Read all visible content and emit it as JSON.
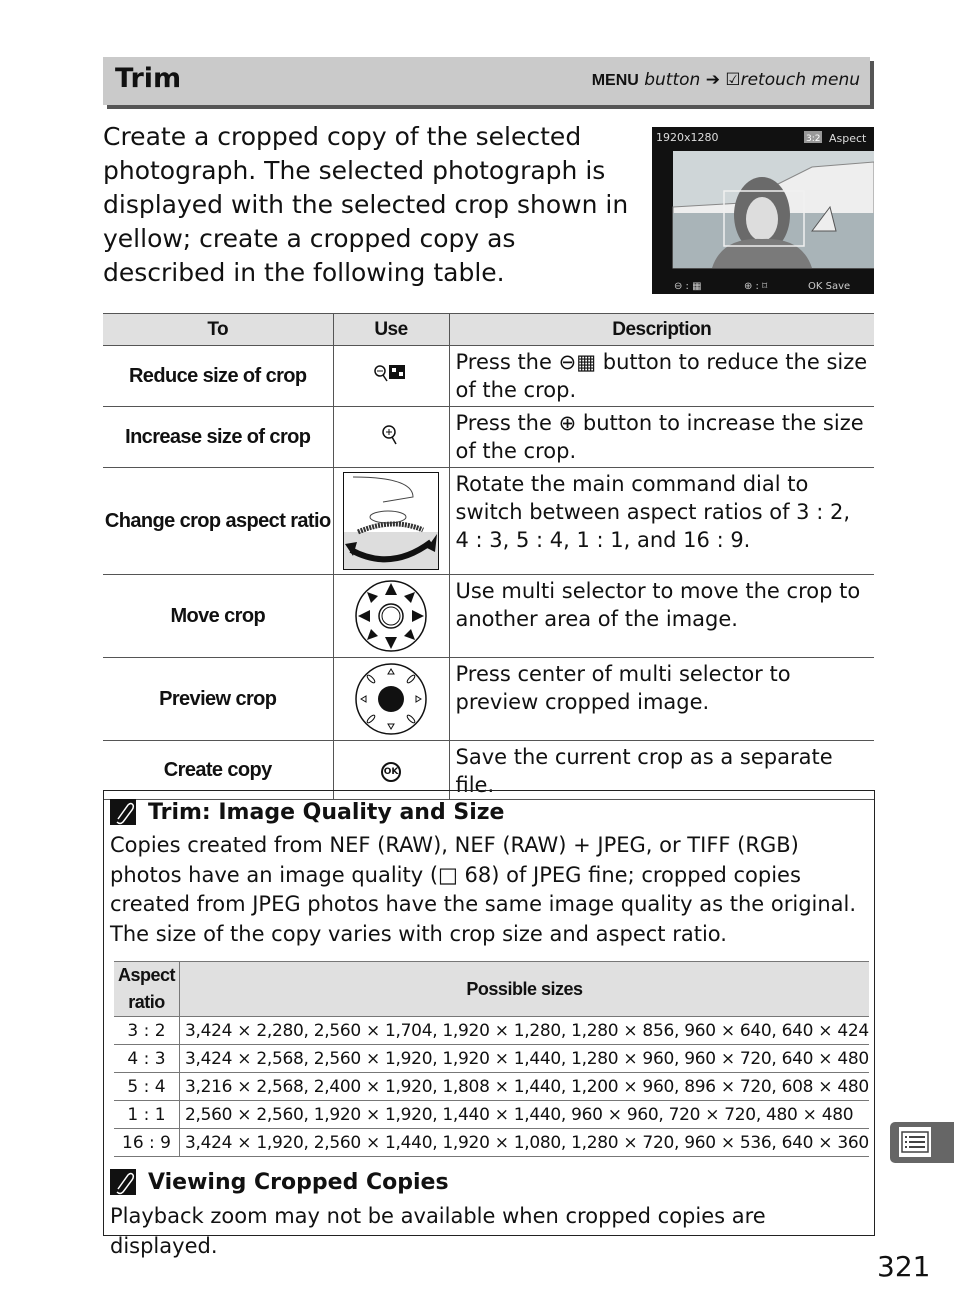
{
  "header": {
    "title": "Trim",
    "path_menu": "MENU",
    "path_button": "button",
    "path_arrow": "➔",
    "path_menu_name": "retouch menu"
  },
  "intro": "Create a cropped copy of the selected photograph.  The selected photograph is displayed with the selected crop shown in yellow; create a cropped copy as described in the following table.",
  "screen": {
    "size": "1920x1280",
    "ratio": "3:2",
    "aspect_label": "Aspect",
    "save": "Save",
    "ok": "OK"
  },
  "table": {
    "headers": [
      "To",
      "Use",
      "Description"
    ],
    "rows": [
      {
        "to": "Reduce size of crop",
        "icon": "zoom-out-thumbnail-icon",
        "desc_pre": "Press the",
        "desc_post": "button to reduce the size of the crop."
      },
      {
        "to": "Increase size of crop",
        "icon": "zoom-in-icon",
        "desc_pre": "Press the",
        "desc_post": "button to increase the size of the crop."
      },
      {
        "to": "Change crop aspect ratio",
        "icon": "main-command-dial-icon",
        "desc": "Rotate the main command dial to switch between aspect ratios of 3 : 2, 4 : 3, 5 : 4, 1 : 1, and 16 : 9."
      },
      {
        "to": "Move crop",
        "icon": "multi-selector-icon",
        "desc": "Use multi selector to move the crop to another area of the image."
      },
      {
        "to": "Preview crop",
        "icon": "multi-selector-center-icon",
        "desc": "Press center of multi selector to preview cropped image."
      },
      {
        "to": "Create copy",
        "icon": "ok-button-icon",
        "desc": "Save the current crop as a separate file."
      }
    ]
  },
  "note1": {
    "title": "Trim: Image Quality and Size",
    "text": "Copies created from NEF (RAW), NEF (RAW) + JPEG, or TIFF (RGB) photos have an image quality (□ 68) of JPEG fine; cropped copies created from JPEG photos have the same image quality as the original.  The size of the copy varies with crop size and aspect ratio.",
    "sizes_headers": [
      "Aspect ratio",
      "Possible sizes"
    ],
    "sizes": [
      {
        "ratio": "3 : 2",
        "sizes": "3,424 × 2,280, 2,560 × 1,704, 1,920 × 1,280, 1,280 × 856, 960 × 640, 640 × 424"
      },
      {
        "ratio": "4 : 3",
        "sizes": "3,424 × 2,568, 2,560 × 1,920, 1,920 × 1,440, 1,280 × 960, 960 × 720, 640 × 480"
      },
      {
        "ratio": "5 : 4",
        "sizes": "3,216 × 2,568, 2,400 × 1,920, 1,808 × 1,440, 1,200 × 960, 896 × 720, 608 × 480"
      },
      {
        "ratio": "1 : 1",
        "sizes": "2,560 × 2,560, 1,920 × 1,920, 1,440 × 1,440,  960 × 960, 720 × 720, 480 × 480"
      },
      {
        "ratio": "16 : 9",
        "sizes": "3,424 × 1,920, 2,560 × 1,440, 1,920 × 1,080, 1,280 × 720, 960 × 536, 640 × 360"
      }
    ]
  },
  "note2": {
    "title": "Viewing Cropped Copies",
    "text": "Playback zoom may not be available when cropped copies are displayed."
  },
  "page_number": "321"
}
